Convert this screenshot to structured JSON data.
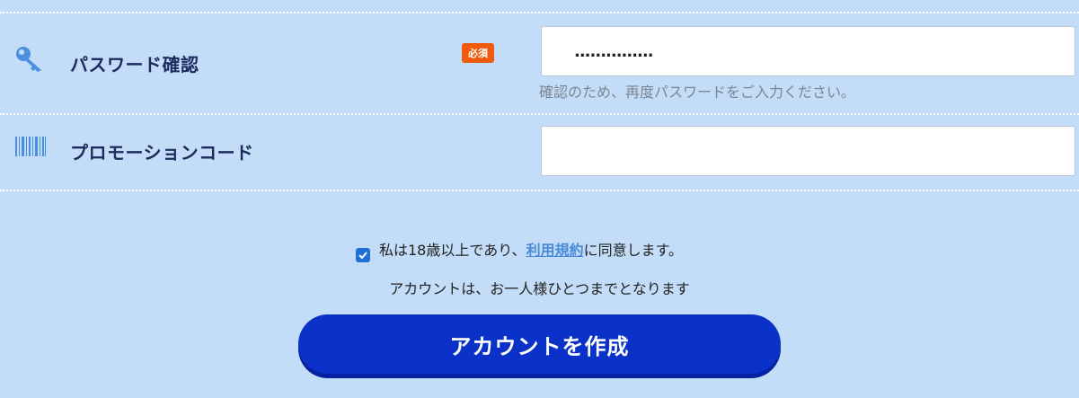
{
  "password_confirm": {
    "label": "パスワード確認",
    "required_badge": "必須",
    "value": "...............",
    "hint": "確認のため、再度パスワードをご入力ください。",
    "icon": "key-icon"
  },
  "promo_code": {
    "label": "プロモーションコード",
    "value": "",
    "icon": "barcode-icon"
  },
  "agreement": {
    "checked": true,
    "text_before": "私は18歳以上であり、",
    "link_text": "利用規約",
    "text_after": "に同意します。"
  },
  "note": "アカウントは、お一人様ひとつまでとなります",
  "submit_label": "アカウントを作成",
  "colors": {
    "background": "#c3ddf8",
    "label": "#1c2a5e",
    "badge": "#f05a0e",
    "button": "#0a32c8",
    "link": "#4a8ad8",
    "icon": "#4a8fe0"
  }
}
